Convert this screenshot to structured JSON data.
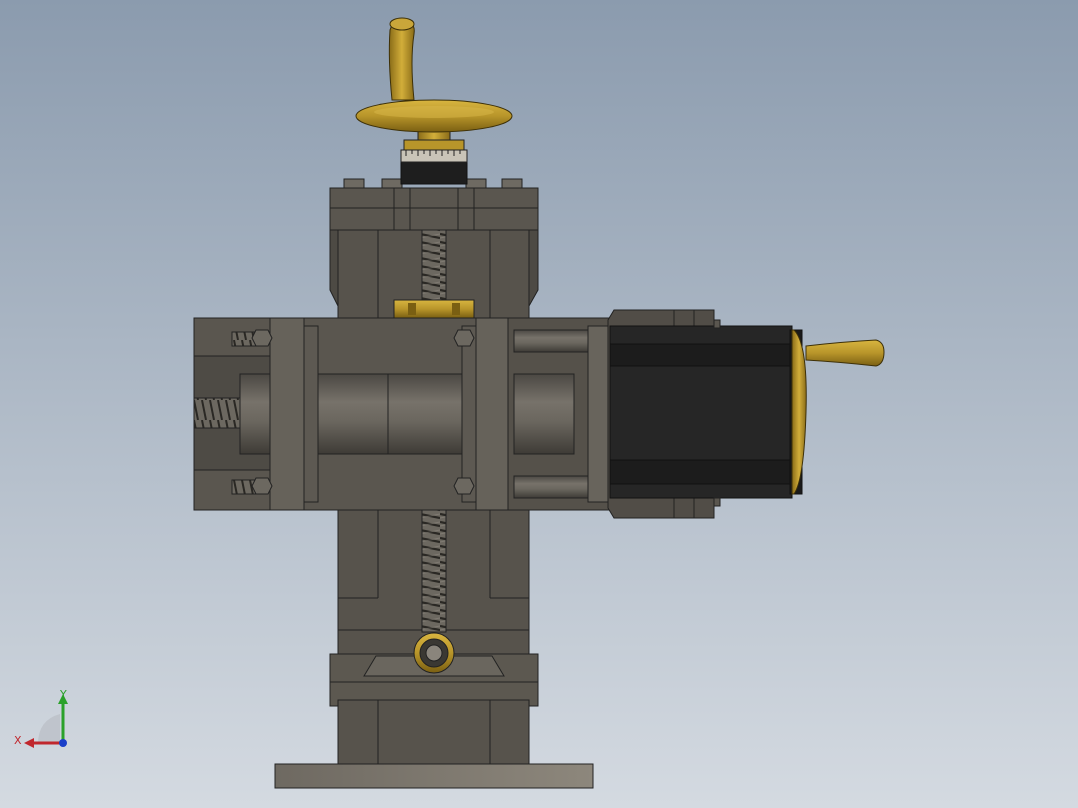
{
  "viewport": {
    "background_top": "#8b9bae",
    "background_bottom": "#d4dae1"
  },
  "model": {
    "steel_color": "#5a5650",
    "steel_light": "#7a756c",
    "steel_dark": "#3c3934",
    "brass_color": "#b8952a",
    "brass_dark": "#7a5f12",
    "motor_color": "#2a2a2a",
    "edge_color": "#1c1c1c"
  },
  "triad": {
    "x_label": "X",
    "y_label": "Y",
    "x_color": "#c0272d",
    "y_color": "#2aa12a",
    "z_color": "#1a3fc9"
  }
}
